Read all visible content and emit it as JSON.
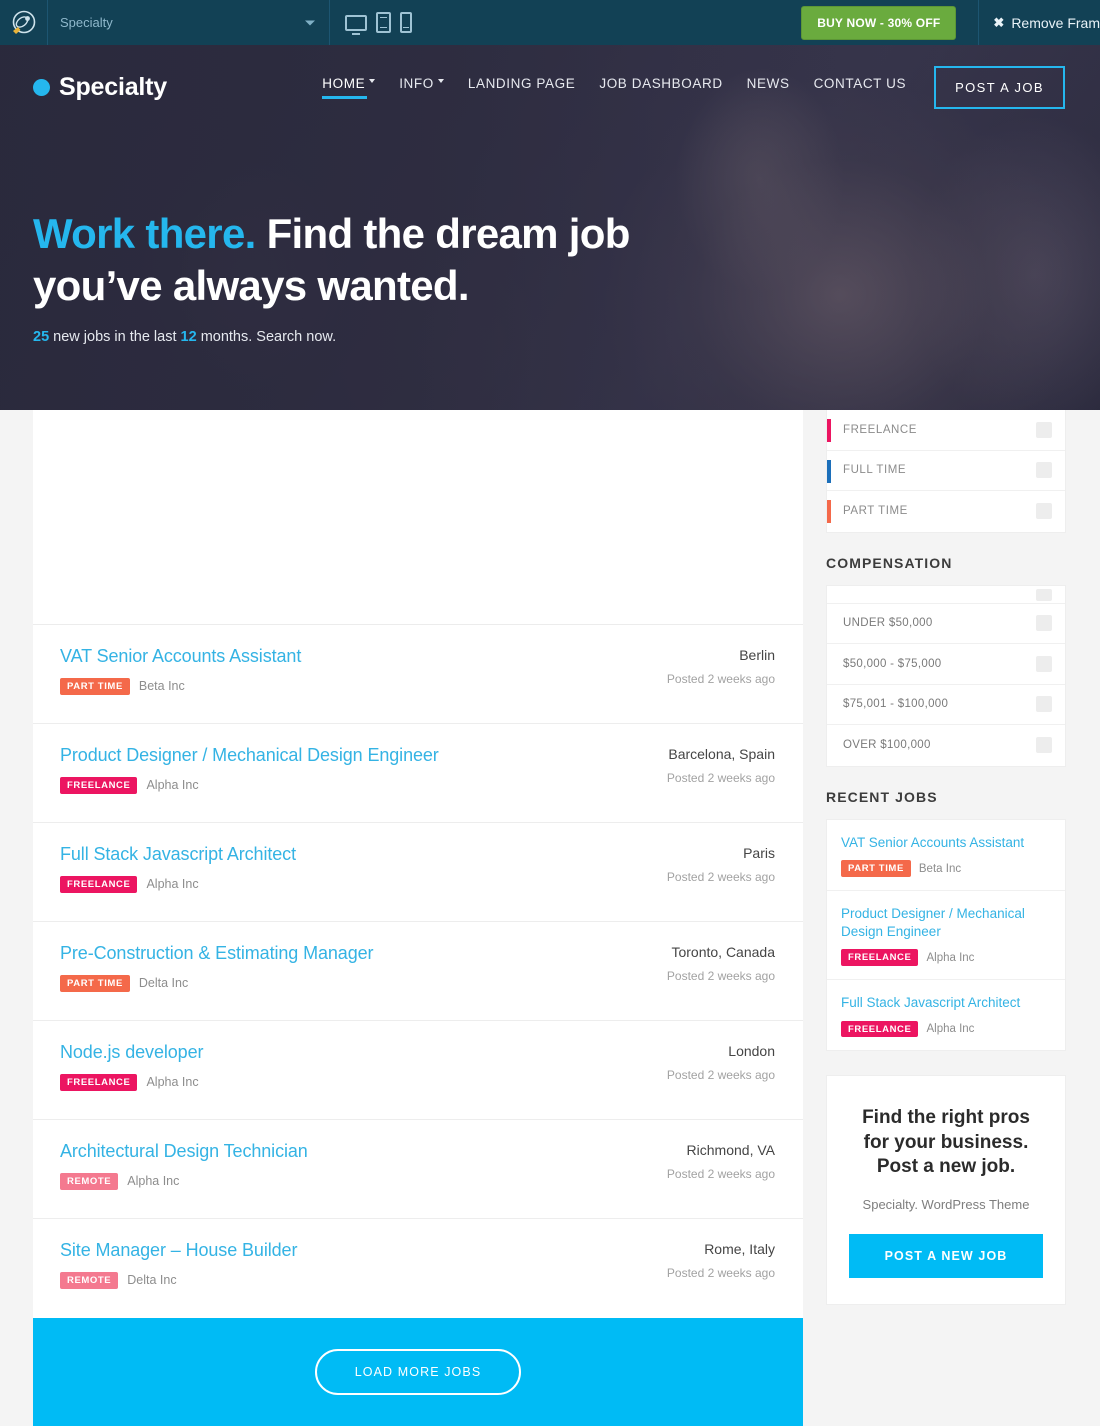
{
  "preview_bar": {
    "logo_icon": "themeforest-logo-icon",
    "theme_select_value": "Specialty",
    "devices": [
      {
        "name": "desktop-preview-icon",
        "label": "Desktop"
      },
      {
        "name": "tablet-preview-icon",
        "label": "Tablet"
      },
      {
        "name": "phone-preview-icon",
        "label": "Phone"
      }
    ],
    "buy_label": "BUY NOW - 30% OFF",
    "remove_frame_label": "Remove Fram",
    "close_icon": "✖",
    "colors": {
      "bar_bg": "#124155",
      "buy_bg": "#6aab3e"
    }
  },
  "header": {
    "brand": "Specialty",
    "brand_dot_color": "#25b7ee",
    "menu": [
      {
        "label": "HOME",
        "has_caret": true,
        "active": true
      },
      {
        "label": "INFO",
        "has_caret": true,
        "active": false
      },
      {
        "label": "LANDING PAGE",
        "has_caret": false,
        "active": false
      },
      {
        "label": "JOB DASHBOARD",
        "has_caret": false,
        "active": false
      },
      {
        "label": "NEWS",
        "has_caret": false,
        "active": false
      },
      {
        "label": "CONTACT US",
        "has_caret": false,
        "active": false
      }
    ],
    "cta_label": "POST A JOB"
  },
  "hero": {
    "title_accent": "Work there.",
    "title_rest": " Find the dream job",
    "title_line2": "you’ve always wanted.",
    "sub_count": "25",
    "sub_mid": " new jobs in the last ",
    "sub_months": "12",
    "sub_end": " months. Search now."
  },
  "jobs": [
    {
      "title": "VAT Senior Accounts Assistant",
      "tag": "PART TIME",
      "tag_type": "parttime",
      "company": "Beta Inc",
      "location": "Berlin",
      "posted": "Posted 2 weeks ago"
    },
    {
      "title": "Product Designer / Mechanical Design Engineer",
      "tag": "FREELANCE",
      "tag_type": "freelance",
      "company": "Alpha Inc",
      "location": "Barcelona, Spain",
      "posted": "Posted 2 weeks ago"
    },
    {
      "title": "Full Stack Javascript Architect",
      "tag": "FREELANCE",
      "tag_type": "freelance",
      "company": "Alpha Inc",
      "location": "Paris",
      "posted": "Posted 2 weeks ago"
    },
    {
      "title": "Pre-Construction & Estimating Manager",
      "tag": "PART TIME",
      "tag_type": "parttime",
      "company": "Delta Inc",
      "location": "Toronto, Canada",
      "posted": "Posted 2 weeks ago"
    },
    {
      "title": "Node.js developer",
      "tag": "FREELANCE",
      "tag_type": "freelance",
      "company": "Alpha Inc",
      "location": "London",
      "posted": "Posted 2 weeks ago"
    },
    {
      "title": "Architectural Design Technician",
      "tag": "REMOTE",
      "tag_type": "remote",
      "company": "Alpha Inc",
      "location": "Richmond, VA",
      "posted": "Posted 2 weeks ago"
    },
    {
      "title": "Site Manager – House Builder",
      "tag": "REMOTE",
      "tag_type": "remote",
      "company": "Delta Inc",
      "location": "Rome, Italy",
      "posted": "Posted 2 weeks ago"
    }
  ],
  "load_more_label": "LOAD MORE JOBS",
  "sidebar": {
    "job_type_filters": [
      {
        "label": "FREELANCE",
        "color": "#ec1561"
      },
      {
        "label": "FULL TIME",
        "color": "#1c6fba"
      },
      {
        "label": "PART TIME",
        "color": "#f4694a"
      }
    ],
    "compensation_heading": "COMPENSATION",
    "compensation_filters": [
      {
        "label": "UNDER $50,000"
      },
      {
        "label": "$50,000 - $75,000"
      },
      {
        "label": "$75,001 - $100,000"
      },
      {
        "label": "OVER $100,000"
      }
    ],
    "recent_heading": "RECENT JOBS",
    "recent_jobs": [
      {
        "title": "VAT Senior Accounts Assistant",
        "tag": "PART TIME",
        "tag_type": "parttime",
        "company": "Beta Inc"
      },
      {
        "title": "Product Designer / Mechanical Design Engineer",
        "tag": "FREELANCE",
        "tag_type": "freelance",
        "company": "Alpha Inc"
      },
      {
        "title": "Full Stack Javascript Architect",
        "tag": "FREELANCE",
        "tag_type": "freelance",
        "company": "Alpha Inc"
      }
    ],
    "promo": {
      "title": "Find the right pros for your business. Post a new job.",
      "subtitle": "Specialty. WordPress Theme",
      "button_label": "POST A NEW JOB"
    }
  },
  "colors": {
    "accent_blue": "#00bbf5",
    "link_blue": "#34b3e4",
    "hero_dark": "#2e2d42"
  }
}
